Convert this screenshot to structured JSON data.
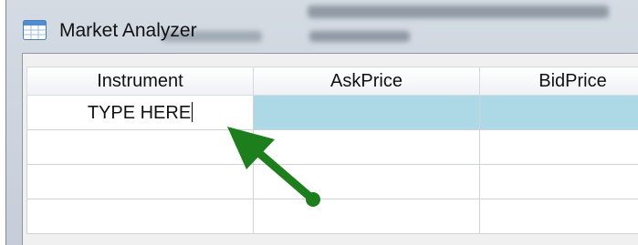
{
  "window": {
    "title": "Market Analyzer",
    "icon": "window-app-icon"
  },
  "grid": {
    "columns": [
      "Instrument",
      "AskPrice",
      "BidPrice"
    ],
    "rows": [
      {
        "instrument": "TYPE HERE",
        "askprice": "",
        "bidprice": ""
      },
      {
        "instrument": "",
        "askprice": "",
        "bidprice": ""
      },
      {
        "instrument": "",
        "askprice": "",
        "bidprice": ""
      },
      {
        "instrument": "",
        "askprice": "",
        "bidprice": ""
      }
    ],
    "selected_row_color": "#add8e6"
  },
  "annotation": {
    "arrow_color": "#1c7f1c",
    "icon": "arrow-pointer-icon"
  }
}
